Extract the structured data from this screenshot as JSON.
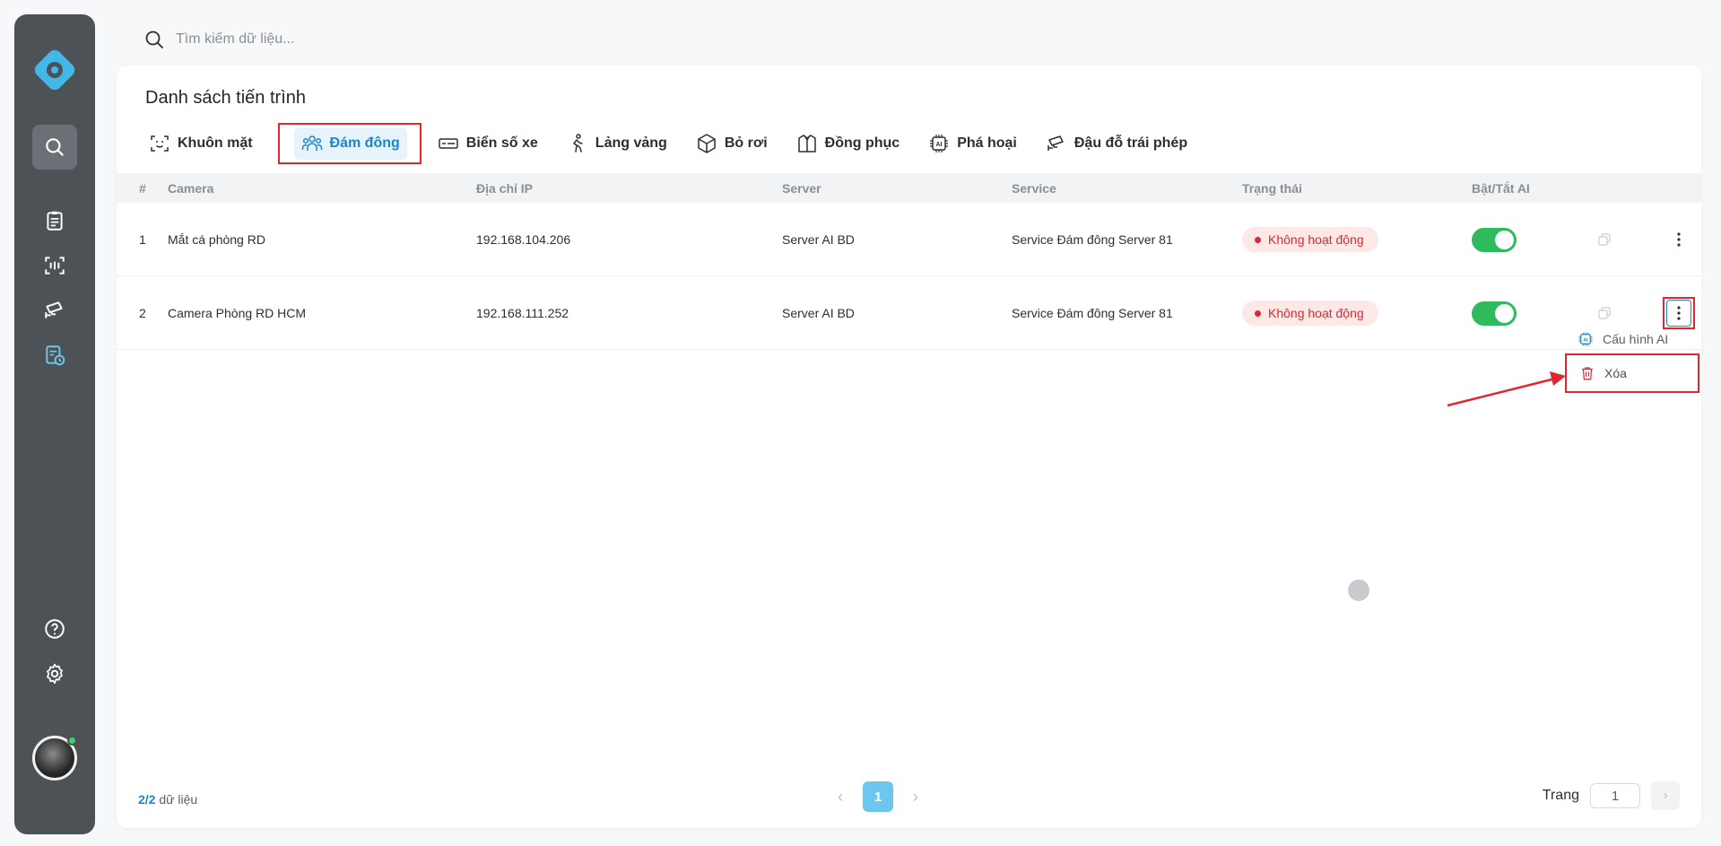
{
  "search": {
    "placeholder": "Tìm kiếm dữ liệu..."
  },
  "card": {
    "title": "Danh sách tiến trình",
    "tabs": [
      {
        "label": "Khuôn mặt",
        "icon": "face-scan-icon"
      },
      {
        "label": "Đám đông",
        "icon": "crowd-icon",
        "active": true
      },
      {
        "label": "Biển số xe",
        "icon": "license-plate-icon"
      },
      {
        "label": "Lảng vảng",
        "icon": "walking-icon"
      },
      {
        "label": "Bỏ rơi",
        "icon": "box-icon"
      },
      {
        "label": "Đồng phục",
        "icon": "uniform-icon"
      },
      {
        "label": "Phá hoại",
        "icon": "ai-chip-icon"
      },
      {
        "label": "Đậu đỗ trái phép",
        "icon": "cctv-camera-icon"
      }
    ]
  },
  "table": {
    "headers": [
      "#",
      "Camera",
      "Địa chỉ IP",
      "Server",
      "Service",
      "Trạng thái",
      "Bật/Tắt AI"
    ],
    "rows": [
      {
        "idx": "1",
        "camera": "Mắt cá phòng RD",
        "ip": "192.168.104.206",
        "server": "Server AI BD",
        "service": "Service Đám đông Server 81",
        "status": "Không hoạt động",
        "ai_on": true
      },
      {
        "idx": "2",
        "camera": "Camera Phòng RD HCM",
        "ip": "192.168.111.252",
        "server": "Server AI BD",
        "service": "Service Đám đông Server 81",
        "status": "Không hoạt động",
        "ai_on": true
      }
    ]
  },
  "dropdown": {
    "items": [
      {
        "label": "Cấu hình AI",
        "icon": "ai-chip-icon"
      },
      {
        "label": "Xóa",
        "icon": "trash-icon"
      }
    ]
  },
  "footer": {
    "count_current": "2",
    "count_total": "/2",
    "count_suffix": " dữ liệu",
    "current_page": "1",
    "page_label": "Trang",
    "page_input": "1"
  },
  "colors": {
    "accent": "#1e86c8",
    "danger": "#e0262f",
    "toggle_on": "#2dbb5d",
    "sidebar": "#4d5257"
  }
}
